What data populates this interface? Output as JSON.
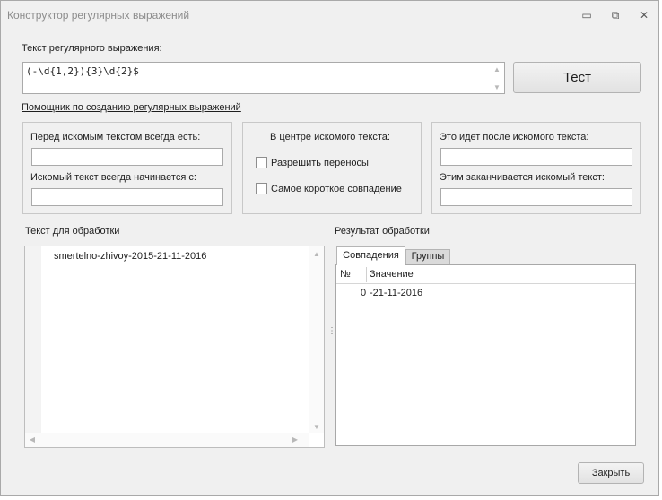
{
  "window": {
    "title": "Конструктор регулярных выражений",
    "minimize_glyph": "▭",
    "restore_glyph": "⧉",
    "close_glyph": "✕"
  },
  "regex": {
    "label": "Текст регулярного выражения:",
    "value": "(-\\d{1,2}){3}\\d{2}$",
    "test_button": "Тест",
    "helper_link": "Помощник по созданию регулярных выражений"
  },
  "helper": {
    "before": {
      "label_always": "Перед искомым текстом всегда есть:",
      "always_value": "",
      "label_starts": "Искомый текст всегда начинается с:",
      "starts_value": ""
    },
    "center": {
      "title": "В центре искомого текста:",
      "allow_wrap": "Разрешить переносы",
      "shortest_match": "Самое короткое совпадение"
    },
    "after": {
      "label_after": "Это идет после искомого текста:",
      "after_value": "",
      "label_ends": "Этим заканчивается искомый текст:",
      "ends_value": ""
    }
  },
  "input": {
    "label": "Текст для обработки",
    "text": "smertelno-zhivoy-2015-21-11-2016"
  },
  "result": {
    "label": "Результат обработки",
    "tabs": [
      "Совпадения",
      "Группы"
    ],
    "columns": [
      "№",
      "Значение"
    ],
    "rows": [
      {
        "num": "0",
        "value": "-21-11-2016"
      }
    ]
  },
  "footer": {
    "close_button": "Закрыть"
  },
  "icons": {
    "scroll_up": "▲",
    "scroll_down": "▼",
    "scroll_left": "◀",
    "scroll_right": "▶",
    "grip": "⋮"
  }
}
